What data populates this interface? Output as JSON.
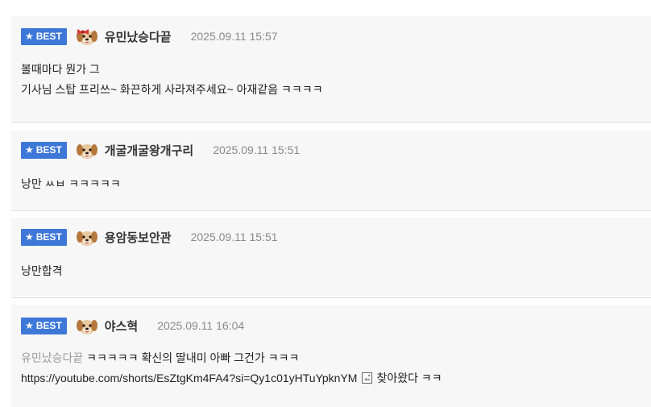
{
  "badge_label": "BEST",
  "comments": [
    {
      "nickname": "유민났승다끝",
      "timestamp": "2025.09.11 15:57",
      "avatar": "puppy-with-red-bow-icon",
      "lines": [
        "볼때마다 뭔가 그",
        "기사님 스탑 프리쓰~ 화끈하게 사라져주세요~ 아재같음 ㅋㅋㅋㅋ"
      ]
    },
    {
      "nickname": "개굴개굴왕개구리",
      "timestamp": "2025.09.11 15:51",
      "avatar": "puppy-face-icon",
      "lines": [
        "낭만 ㅆㅂ ㅋㅋㅋㅋㅋ"
      ]
    },
    {
      "nickname": "용암동보안관",
      "timestamp": "2025.09.11 15:51",
      "avatar": "puppy-face-icon",
      "lines": [
        "낭만합격"
      ]
    },
    {
      "nickname": "야스혁",
      "timestamp": "2025.09.11 16:04",
      "avatar": "puppy-face-icon",
      "mention": "유민났승다끝",
      "line1_text": " ㅋㅋㅋㅋㅋ 확신의 딸내미 아빠 그건가 ㅋㅋㅋ",
      "link": "https://youtube.com/shorts/EsZtgKm4FA4?si=Qy1c01yHTuYpknYM",
      "link_suffix": "찾아왔다 ㅋㅋ"
    }
  ],
  "colors": {
    "badge": "#3d78d8",
    "card_background": "#f7f7f8",
    "timestamp": "#8a8a8a",
    "mention": "#9a9a9a"
  }
}
